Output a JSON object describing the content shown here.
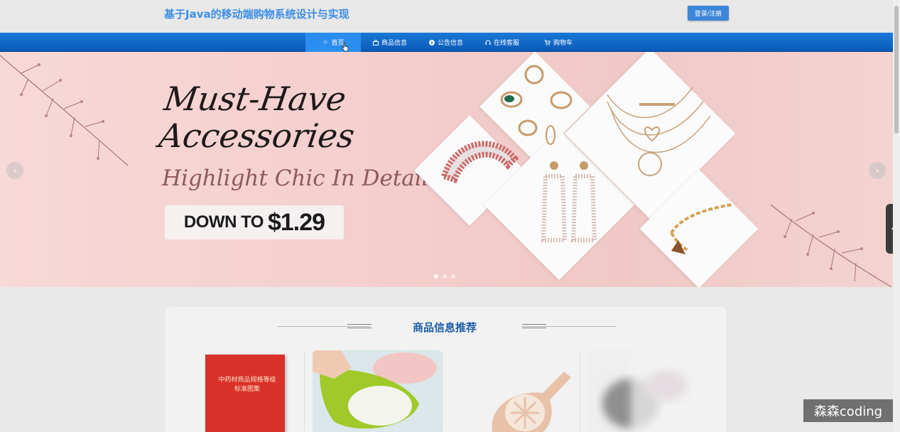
{
  "header": {
    "title": "基于Java的移动端购物系统设计与实现",
    "login_label": "登录/注册"
  },
  "nav": {
    "items": [
      {
        "label": "首页",
        "icon": "star-icon",
        "active": true
      },
      {
        "label": "商品信息",
        "icon": "bag-icon",
        "active": false
      },
      {
        "label": "公告信息",
        "icon": "info-icon",
        "active": false
      },
      {
        "label": "在线客服",
        "icon": "headset-icon",
        "active": false
      },
      {
        "label": "购物车",
        "icon": "cart-icon",
        "active": false
      }
    ]
  },
  "banner": {
    "script_title": "Must-Have\nAccessories",
    "subtitle": "Highlight Chic In Details",
    "price_prefix": "DOWN TO",
    "price_value": "$1.29",
    "slide_count": 3,
    "active_slide": 1
  },
  "section": {
    "title": "商品信息推荐",
    "products": [
      {
        "image": "book",
        "book_title": "中药材商品规格等级标准图集"
      },
      {
        "image": "green-colander"
      },
      {
        "image": "egg-separator"
      },
      {
        "image": "blurred-product"
      }
    ]
  },
  "watermark": "森森coding",
  "colors": {
    "title_blue": "#3d8ee6",
    "nav_blue": "#0a5ab8",
    "button_blue": "#3b86d8",
    "banner_pink": "#f4cfcd",
    "section_title": "#1d5ea8"
  }
}
